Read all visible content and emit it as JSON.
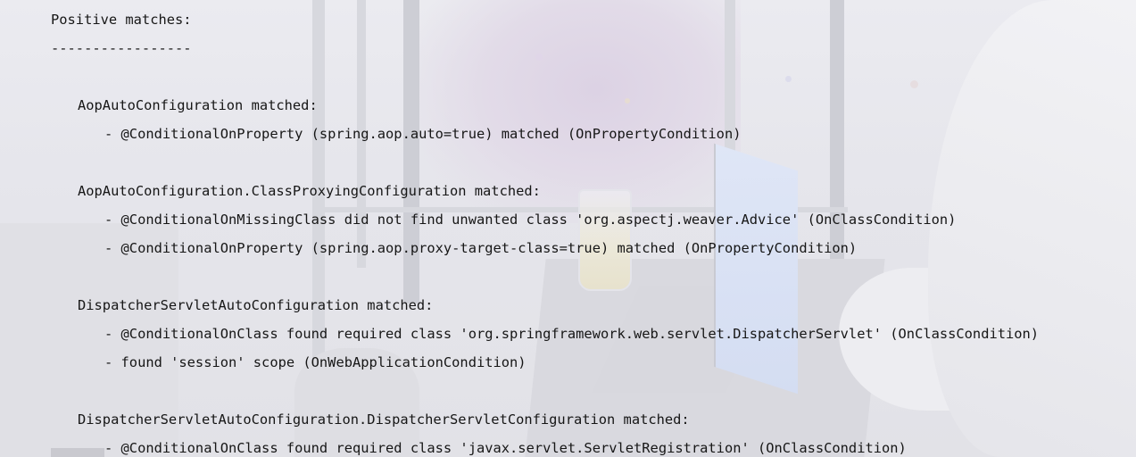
{
  "log": {
    "heading": "Positive matches:",
    "divider": "-----------------",
    "blocks": [
      {
        "title": "AopAutoConfiguration matched:",
        "conditions": [
          "- @ConditionalOnProperty (spring.aop.auto=true) matched (OnPropertyCondition)"
        ]
      },
      {
        "title": "AopAutoConfiguration.ClassProxyingConfiguration matched:",
        "conditions": [
          "- @ConditionalOnMissingClass did not find unwanted class 'org.aspectj.weaver.Advice' (OnClassCondition)",
          "- @ConditionalOnProperty (spring.aop.proxy-target-class=true) matched (OnPropertyCondition)"
        ]
      },
      {
        "title": "DispatcherServletAutoConfiguration matched:",
        "conditions": [
          "- @ConditionalOnClass found required class 'org.springframework.web.servlet.DispatcherServlet' (OnClassCondition)",
          "- found 'session' scope (OnWebApplicationCondition)"
        ]
      },
      {
        "title": "DispatcherServletAutoConfiguration.DispatcherServletConfiguration matched:",
        "conditions": [
          "- @ConditionalOnClass found required class 'javax.servlet.ServletRegistration' (OnClassCondition)"
        ]
      }
    ]
  }
}
